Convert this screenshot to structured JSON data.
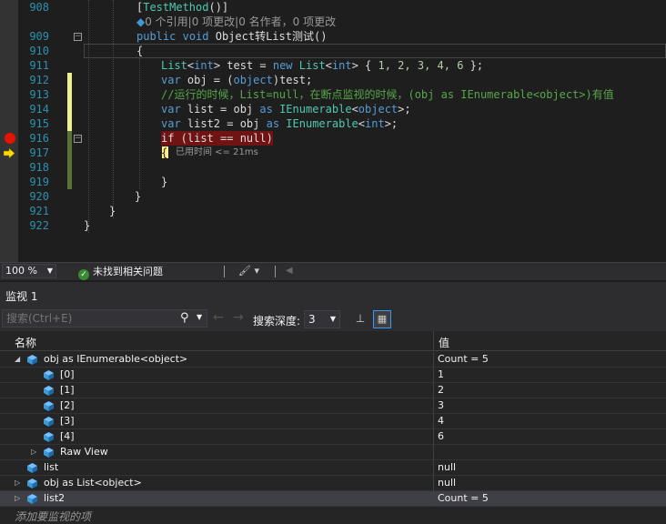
{
  "editor": {
    "lines": [
      {
        "n": "908"
      },
      {
        "n": "909"
      },
      {
        "n": "910"
      },
      {
        "n": "911"
      },
      {
        "n": "912"
      },
      {
        "n": "913"
      },
      {
        "n": "914"
      },
      {
        "n": "915"
      },
      {
        "n": "916"
      },
      {
        "n": "917"
      },
      {
        "n": "918"
      },
      {
        "n": "919"
      },
      {
        "n": "920"
      },
      {
        "n": "921"
      },
      {
        "n": "922"
      }
    ],
    "attribute_open": "[",
    "attribute_name": "TestMethod",
    "attribute_close": "()]",
    "codelens": "0 个引用|0 项更改|0 名作者，0 项更改",
    "sig_public": "public",
    "sig_void": "void",
    "sig_name": "Object转List测试()",
    "brace_open": "{",
    "l911_a": "List",
    "l911_b": "<",
    "l911_c": "int",
    "l911_d": "> test = ",
    "l911_e": "new",
    "l911_f": " List",
    "l911_g": "<",
    "l911_h": "int",
    "l911_i": "> { ",
    "l911_nums": "1, 2, 3, 4, 6",
    "l911_end": " };",
    "l912_var": "var",
    "l912_a": " obj = (",
    "l912_obj": "object",
    "l912_b": ")test;",
    "l913_comment": "//运行的时候，List=null，在断点监视的时候，(obj as IEnumerable<object>)有值",
    "l914_var": "var",
    "l914_a": " list = obj ",
    "l914_as": "as",
    "l914_b": " ",
    "l914_ty": "IEnumerable",
    "l914_c": "<",
    "l914_obj": "object",
    "l914_d": ">;",
    "l915_var": "var",
    "l915_a": " list2 = obj ",
    "l915_as": "as",
    "l915_b": " ",
    "l915_ty": "IEnumerable",
    "l915_c": "<",
    "l915_int": "int",
    "l915_d": ">;",
    "l916_code": "if (list == null)",
    "l917_brace": "{",
    "elapsed": "已用时间 <= 21ms",
    "l919_brace": "}",
    "l920_brace": "}",
    "l921_brace": "}",
    "l922_brace": "}"
  },
  "status": {
    "zoom": "100 %",
    "issues": "未找到相关问题"
  },
  "watch": {
    "title": "监视 1",
    "search_placeholder": "搜索(Ctrl+E)",
    "depth_label": "搜索深度:",
    "depth_value": "3",
    "col_name": "名称",
    "col_value": "值",
    "rows": [
      {
        "name": "obj as IEnumerable<object>",
        "value": "Count = 5"
      },
      {
        "name": "[0]",
        "value": "1"
      },
      {
        "name": "[1]",
        "value": "2"
      },
      {
        "name": "[2]",
        "value": "3"
      },
      {
        "name": "[3]",
        "value": "4"
      },
      {
        "name": "[4]",
        "value": "6"
      },
      {
        "name": "Raw View",
        "value": ""
      },
      {
        "name": "list",
        "value": "null"
      },
      {
        "name": "obj as List<object>",
        "value": "null"
      },
      {
        "name": "list2",
        "value": "Count = 5"
      }
    ],
    "add_placeholder": "添加要监视的项"
  },
  "colors": {
    "keyword": "#569cd6",
    "type": "#4ec9b0",
    "comment": "#57a64a",
    "number": "#b5cea8",
    "breakpoint": "#e51400",
    "breakpoint_line": "#6f1313",
    "linenumber": "#2b91af"
  },
  "icons": [
    "breakpoint-icon",
    "current-statement-arrow-icon",
    "fold-icon",
    "check-icon",
    "search-icon",
    "back-arrow-icon",
    "forward-arrow-icon",
    "pin-icon",
    "view-icon",
    "cube-icon",
    "expand-arrow-icon"
  ]
}
